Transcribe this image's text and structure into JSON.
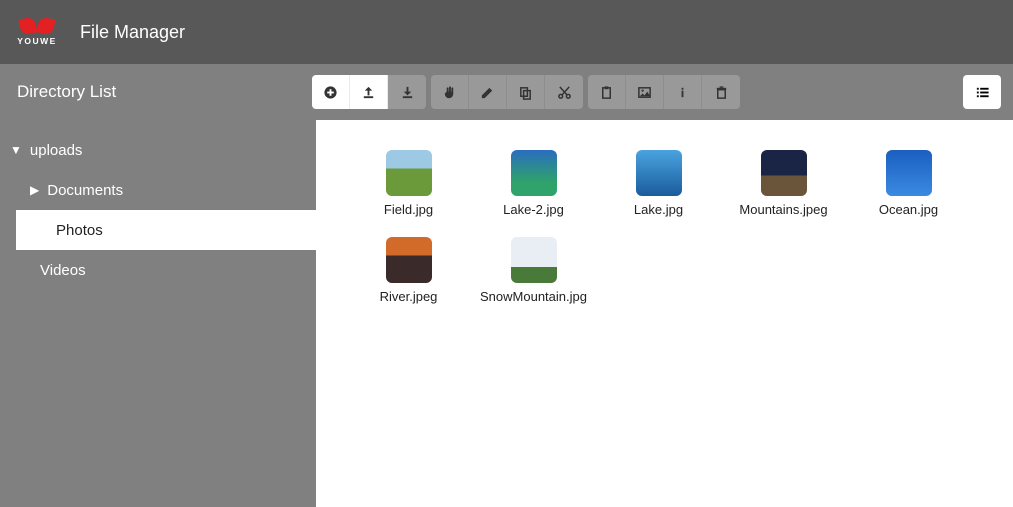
{
  "header": {
    "logo_text": "YOUWE",
    "app_title": "File Manager"
  },
  "subheader": {
    "directory_list_label": "Directory List"
  },
  "toolbar": {
    "create": "create",
    "upload": "upload",
    "download": "download",
    "select": "select",
    "edit": "edit",
    "copy": "copy",
    "cut": "cut",
    "paste": "paste",
    "image": "image",
    "info": "info",
    "delete": "delete",
    "list_view": "list-view"
  },
  "sidebar": {
    "items": [
      {
        "label": "uploads",
        "level": "root",
        "expanded": true,
        "selected": false,
        "has_children": true
      },
      {
        "label": "Documents",
        "level": "child",
        "expanded": false,
        "selected": false,
        "has_children": true
      },
      {
        "label": "Photos",
        "level": "leaf",
        "expanded": false,
        "selected": true,
        "has_children": false
      },
      {
        "label": "Videos",
        "level": "leaf",
        "expanded": false,
        "selected": false,
        "has_children": false
      }
    ]
  },
  "files": [
    {
      "name": "Field.jpg",
      "thumb_class": "th-field"
    },
    {
      "name": "Lake-2.jpg",
      "thumb_class": "th-lake2"
    },
    {
      "name": "Lake.jpg",
      "thumb_class": "th-lake"
    },
    {
      "name": "Mountains.jpeg",
      "thumb_class": "th-mountains"
    },
    {
      "name": "Ocean.jpg",
      "thumb_class": "th-ocean"
    },
    {
      "name": "River.jpeg",
      "thumb_class": "th-river"
    },
    {
      "name": "SnowMountain.jpg",
      "thumb_class": "th-snow"
    }
  ]
}
